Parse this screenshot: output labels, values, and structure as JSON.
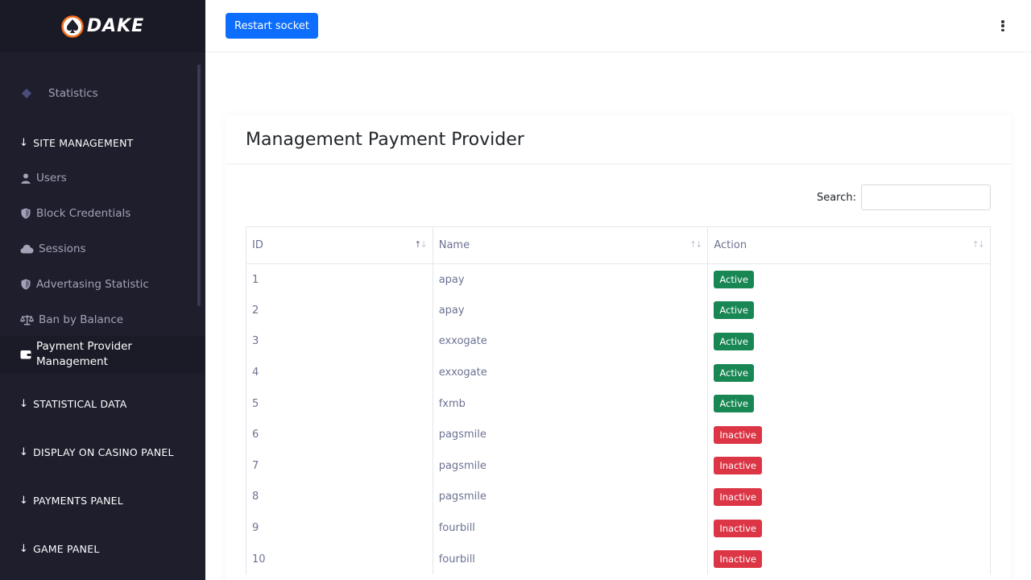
{
  "brand": {
    "name": "DAKE"
  },
  "sidebar": {
    "top_item": {
      "label": "Statistics",
      "icon": "diamond-icon"
    },
    "sections": [
      {
        "title": "SITE MANAGEMENT"
      },
      {
        "title": "STATISTICAL DATA"
      },
      {
        "title": "DISPLAY ON CASINO PANEL"
      },
      {
        "title": "PAYMENTS PANEL"
      },
      {
        "title": "GAME PANEL"
      }
    ],
    "items": [
      {
        "label": "Users",
        "icon": "user-icon"
      },
      {
        "label": "Block Credentials",
        "icon": "shield-icon"
      },
      {
        "label": "Sessions",
        "icon": "cloud-icon"
      },
      {
        "label": "Advertasing Statistic",
        "icon": "shield-icon"
      },
      {
        "label": "Ban by Balance",
        "icon": "scale-icon"
      },
      {
        "label_line1": "Payment Provider",
        "label_line2": "Management",
        "icon": "wallet-icon"
      }
    ]
  },
  "topbar": {
    "restart_label": "Restart socket"
  },
  "page": {
    "title": "Management Payment Provider",
    "search_label": "Search:",
    "search_value": ""
  },
  "table": {
    "headers": [
      "ID",
      "Name",
      "Action"
    ],
    "rows": [
      {
        "id": "1",
        "name": "apay",
        "action": "Active"
      },
      {
        "id": "2",
        "name": "apay",
        "action": "Active"
      },
      {
        "id": "3",
        "name": "exxogate",
        "action": "Active"
      },
      {
        "id": "4",
        "name": "exxogate",
        "action": "Active"
      },
      {
        "id": "5",
        "name": "fxmb",
        "action": "Active"
      },
      {
        "id": "6",
        "name": "pagsmile",
        "action": "Inactive"
      },
      {
        "id": "7",
        "name": "pagsmile",
        "action": "Inactive"
      },
      {
        "id": "8",
        "name": "pagsmile",
        "action": "Inactive"
      },
      {
        "id": "9",
        "name": "fourbill",
        "action": "Inactive"
      },
      {
        "id": "10",
        "name": "fourbill",
        "action": "Inactive"
      }
    ]
  },
  "colors": {
    "sidebar_bg": "#1e1e2d",
    "primary": "#0d6efd",
    "active_badge": "#198754",
    "inactive_badge": "#dc3545",
    "brand_accent": "#f36f21"
  }
}
